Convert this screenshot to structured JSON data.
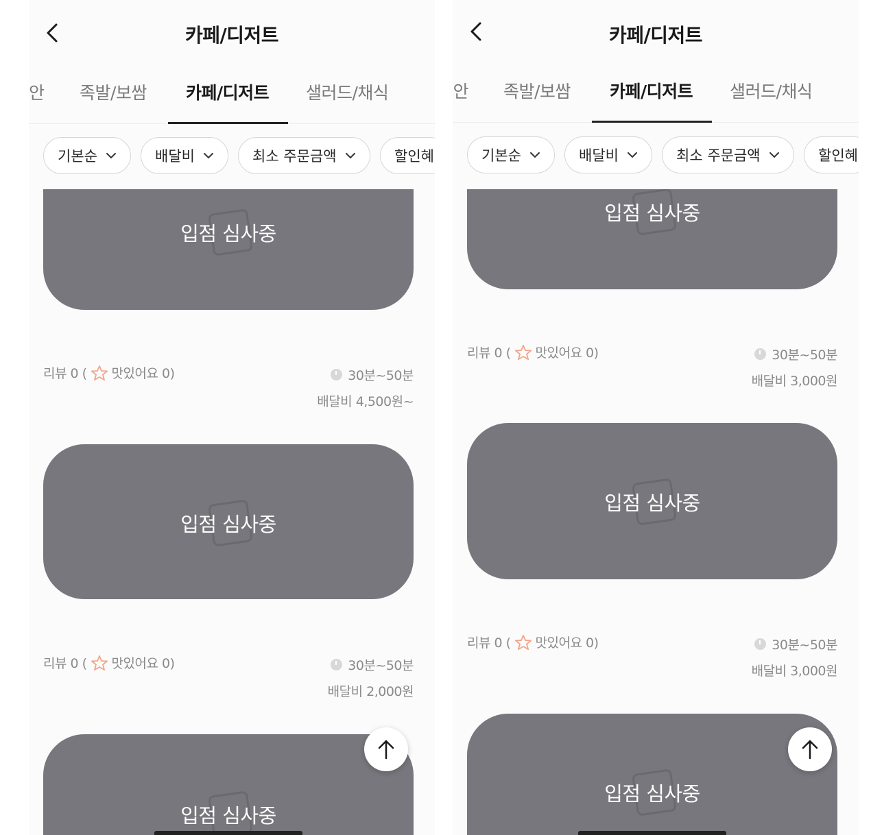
{
  "screens": [
    {
      "header": {
        "title": "카페/디저트"
      },
      "tabs": [
        {
          "label": "안",
          "active": false
        },
        {
          "label": "족발/보쌈",
          "active": false
        },
        {
          "label": "카페/디저트",
          "active": true
        },
        {
          "label": "샐러드/채식",
          "active": false
        }
      ],
      "filters": [
        {
          "label": "기본순",
          "has_dropdown": true
        },
        {
          "label": "배달비",
          "has_dropdown": true
        },
        {
          "label": "최소 주문금액",
          "has_dropdown": true
        },
        {
          "label": "할인혜",
          "has_dropdown": false
        }
      ],
      "stores": [
        {
          "status_label": "입점 심사중",
          "review_text": "리뷰 0 (",
          "tasty_text": "맛있어요 0)",
          "delivery_time": "30분~50분",
          "delivery_fee": "배달비 4,500원~"
        },
        {
          "status_label": "입점 심사중",
          "review_text": "리뷰 0 (",
          "tasty_text": "맛있어요 0)",
          "delivery_time": "30분~50분",
          "delivery_fee": "배달비 2,000원"
        },
        {
          "status_label": "입점 심사중"
        }
      ]
    },
    {
      "header": {
        "title": "카페/디저트"
      },
      "tabs": [
        {
          "label": "l안",
          "active": false
        },
        {
          "label": "족발/보쌈",
          "active": false
        },
        {
          "label": "카페/디저트",
          "active": true
        },
        {
          "label": "샐러드/채식",
          "active": false
        }
      ],
      "filters": [
        {
          "label": "기본순",
          "has_dropdown": true
        },
        {
          "label": "배달비",
          "has_dropdown": true
        },
        {
          "label": "최소 주문금액",
          "has_dropdown": true
        },
        {
          "label": "할인혜",
          "has_dropdown": false
        }
      ],
      "stores": [
        {
          "status_label": "입점 심사중",
          "review_text": "리뷰 0 (",
          "tasty_text": "맛있어요 0)",
          "delivery_time": "30분~50분",
          "delivery_fee": "배달비 3,000원"
        },
        {
          "status_label": "입점 심사중",
          "review_text": "리뷰 0 (",
          "tasty_text": "맛있어요 0)",
          "delivery_time": "30분~50분",
          "delivery_fee": "배달비 3,000원"
        },
        {
          "status_label": "입점 심사중"
        }
      ]
    }
  ],
  "icons": {
    "back": "chevron-left-icon",
    "dropdown": "chevron-down-icon",
    "star": "star-badge-icon",
    "clock": "clock-icon",
    "scroll_top": "arrow-up-icon"
  },
  "colors": {
    "card_background": "#77777d",
    "star_accent": "#f4a489",
    "tab_underline": "#222222",
    "muted_text": "#8a8a8a"
  }
}
